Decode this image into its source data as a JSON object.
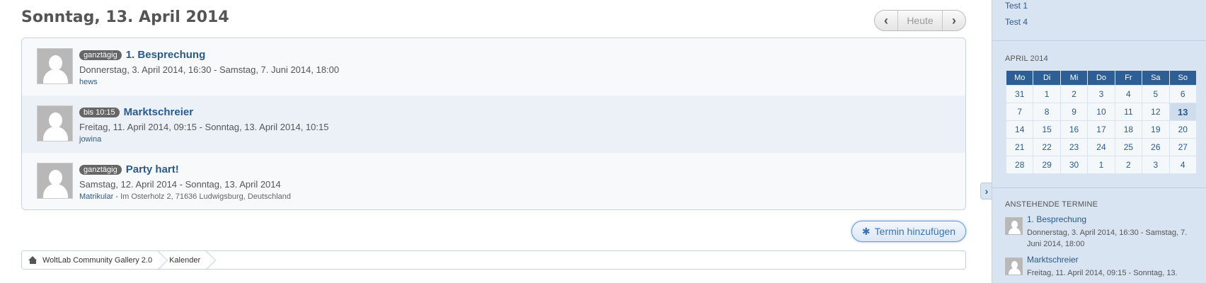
{
  "page_title": "Sonntag, 13. April 2014",
  "nav": {
    "prev_icon": "chevron-left-icon",
    "today_label": "Heute",
    "next_icon": "chevron-right-icon"
  },
  "events": [
    {
      "badge": "ganztägig",
      "title": "1. Besprechung",
      "dates": "Donnerstag, 3. April 2014, 16:30 - Samstag, 7. Juni 2014, 18:00",
      "user": "hews",
      "location": ""
    },
    {
      "badge": "bis 10:15",
      "title": "Marktschreier",
      "dates": "Freitag, 11. April 2014, 09:15 - Sonntag, 13. April 2014, 10:15",
      "user": "jowina",
      "location": ""
    },
    {
      "badge": "ganztägig",
      "title": "Party hart!",
      "dates": "Samstag, 12. April 2014 - Sonntag, 13. April 2014",
      "user": "Matrikular",
      "location": " - Im Osterholz 2, 71636 Ludwigsburg, Deutschland"
    }
  ],
  "add_button": {
    "label": "Termin hinzufügen",
    "icon": "asterisk-icon"
  },
  "breadcrumb": {
    "home_icon": "home-icon",
    "items": [
      "WoltLab Community Gallery 2.0",
      "Kalender"
    ]
  },
  "sidebar": {
    "links": [
      "Test 1",
      "Test 4"
    ],
    "calendar": {
      "heading": "APRIL 2014",
      "weekdays": [
        "Mo",
        "Di",
        "Mi",
        "Do",
        "Fr",
        "Sa",
        "So"
      ],
      "weeks": [
        [
          "31",
          "1",
          "2",
          "3",
          "4",
          "5",
          "6"
        ],
        [
          "7",
          "8",
          "9",
          "10",
          "11",
          "12",
          "13"
        ],
        [
          "14",
          "15",
          "16",
          "17",
          "18",
          "19",
          "20"
        ],
        [
          "21",
          "22",
          "23",
          "24",
          "25",
          "26",
          "27"
        ],
        [
          "28",
          "29",
          "30",
          "1",
          "2",
          "3",
          "4"
        ]
      ],
      "today": "13"
    },
    "upcoming": {
      "heading": "ANSTEHENDE TERMINE",
      "items": [
        {
          "title": "1. Besprechung",
          "dates": "Donnerstag, 3. April 2014, 16:30 - Samstag, 7. Juni 2014, 18:00"
        },
        {
          "title": "Marktschreier",
          "dates": "Freitag, 11. April 2014, 09:15 - Sonntag, 13."
        }
      ]
    },
    "collapse_icon": "chevron-right-icon"
  },
  "colors": {
    "link": "#2a5a8b",
    "calendar_header": "#2d5f96",
    "sidebar_bg": "#d8e4f1"
  }
}
